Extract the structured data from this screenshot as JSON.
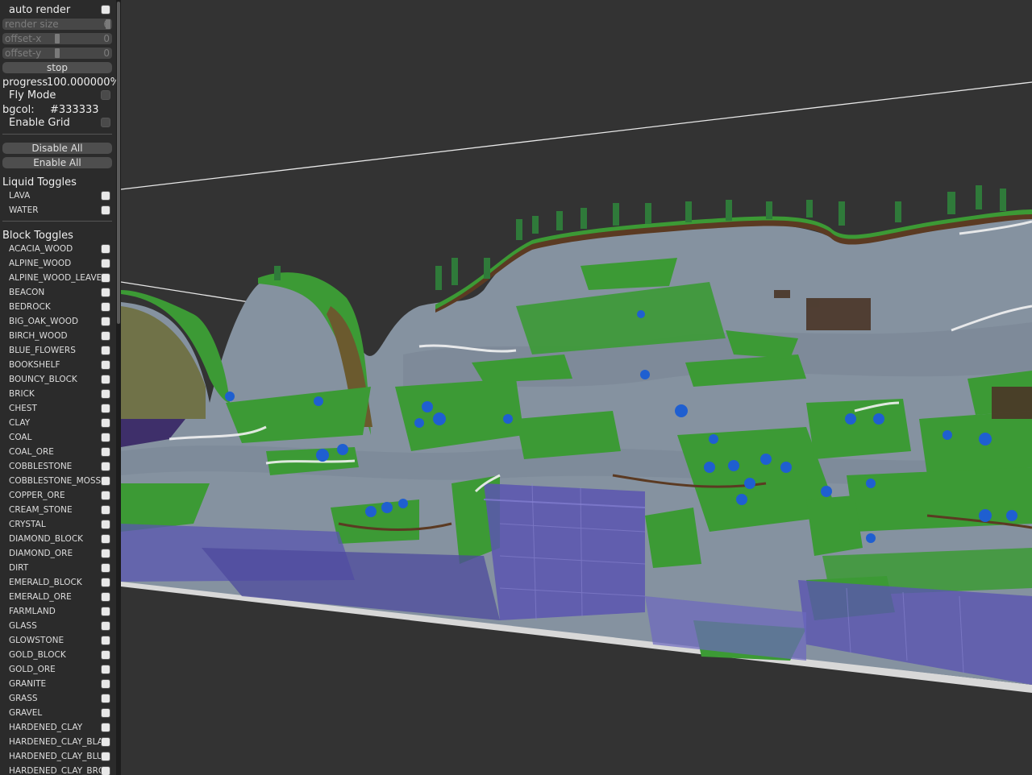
{
  "panel": {
    "auto_render": {
      "label": "auto render",
      "checked": true
    },
    "render_size": {
      "label": "render size",
      "value": "6"
    },
    "offset_x": {
      "label": "offset-x",
      "value": "0"
    },
    "offset_y": {
      "label": "offset-y",
      "value": "0"
    },
    "stop_label": "stop",
    "progress": {
      "label": "progress",
      "value": "100.000000%"
    },
    "fly_mode": {
      "label": "Fly Mode",
      "checked": false
    },
    "bgcol": {
      "label": "bgcol:",
      "value": "#333333"
    },
    "enable_grid": {
      "label": "Enable Grid",
      "checked": false
    },
    "disable_all_label": "Disable All",
    "enable_all_label": "Enable All",
    "liquid_title": "Liquid Toggles",
    "liquids": [
      {
        "label": "LAVA",
        "checked": true
      },
      {
        "label": "WATER",
        "checked": true
      }
    ],
    "block_title": "Block Toggles",
    "blocks": [
      {
        "label": "ACACIA_WOOD",
        "checked": true
      },
      {
        "label": "ALPINE_WOOD",
        "checked": true
      },
      {
        "label": "ALPINE_WOOD_LEAVES",
        "checked": true
      },
      {
        "label": "BEACON",
        "checked": true
      },
      {
        "label": "BEDROCK",
        "checked": true
      },
      {
        "label": "BIG_OAK_WOOD",
        "checked": true
      },
      {
        "label": "BIRCH_WOOD",
        "checked": true
      },
      {
        "label": "BLUE_FLOWERS",
        "checked": true
      },
      {
        "label": "BOOKSHELF",
        "checked": true
      },
      {
        "label": "BOUNCY_BLOCK",
        "checked": true
      },
      {
        "label": "BRICK",
        "checked": true
      },
      {
        "label": "CHEST",
        "checked": true
      },
      {
        "label": "CLAY",
        "checked": true
      },
      {
        "label": "COAL",
        "checked": true
      },
      {
        "label": "COAL_ORE",
        "checked": true
      },
      {
        "label": "COBBLESTONE",
        "checked": true
      },
      {
        "label": "COBBLESTONE_MOSSY",
        "checked": true
      },
      {
        "label": "COPPER_ORE",
        "checked": true
      },
      {
        "label": "CREAM_STONE",
        "checked": true
      },
      {
        "label": "CRYSTAL",
        "checked": true
      },
      {
        "label": "DIAMOND_BLOCK",
        "checked": true
      },
      {
        "label": "DIAMOND_ORE",
        "checked": true
      },
      {
        "label": "DIRT",
        "checked": true
      },
      {
        "label": "EMERALD_BLOCK",
        "checked": true
      },
      {
        "label": "EMERALD_ORE",
        "checked": true
      },
      {
        "label": "FARMLAND",
        "checked": true
      },
      {
        "label": "GLASS",
        "checked": true
      },
      {
        "label": "GLOWSTONE",
        "checked": true
      },
      {
        "label": "GOLD_BLOCK",
        "checked": true
      },
      {
        "label": "GOLD_ORE",
        "checked": true
      },
      {
        "label": "GRANITE",
        "checked": true
      },
      {
        "label": "GRASS",
        "checked": true
      },
      {
        "label": "GRAVEL",
        "checked": true
      },
      {
        "label": "HARDENED_CLAY",
        "checked": true
      },
      {
        "label": "HARDENED_CLAY_BLACK",
        "checked": true
      },
      {
        "label": "HARDENED_CLAY_BLUE",
        "checked": true
      },
      {
        "label": "HARDENED_CLAY_BROWN",
        "checked": true
      }
    ]
  },
  "colors": {
    "background": "#333333",
    "grass": "#3c9a35",
    "stone": "#8592a0",
    "water": "#5a55b0",
    "dirt": "#5b3a22",
    "flowers": "#1f5fd0"
  }
}
